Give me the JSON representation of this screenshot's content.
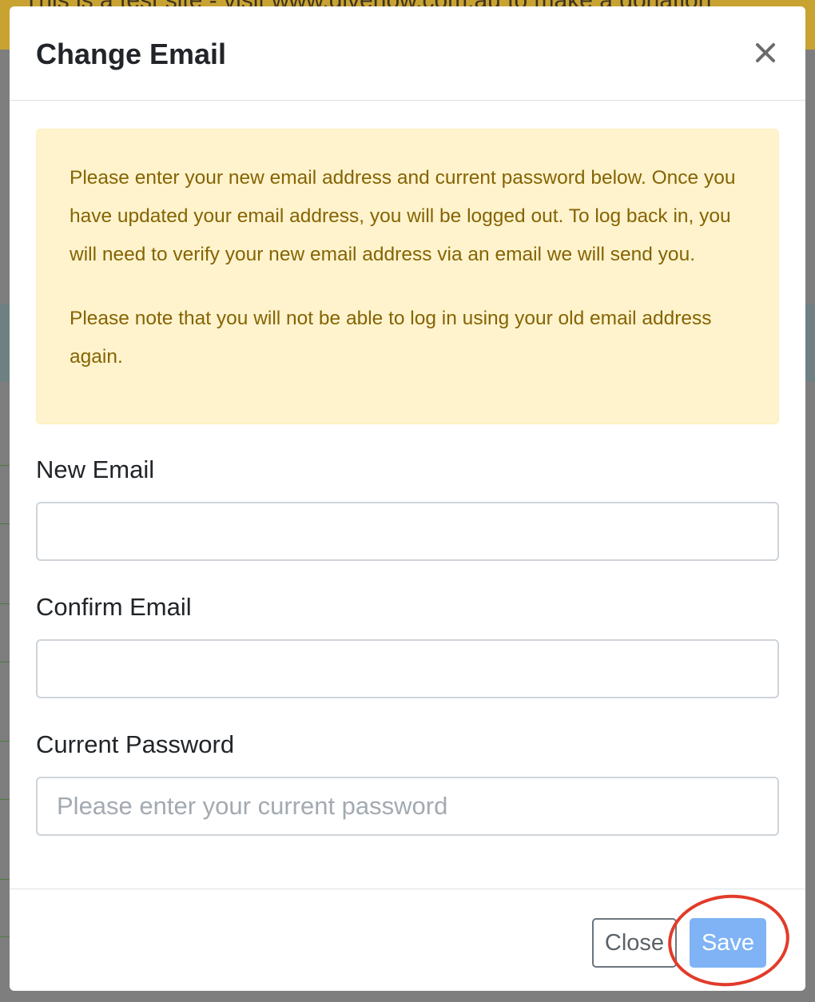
{
  "background": {
    "banner_text": "This is a test site - visit www.givenow.com.au to make a donation"
  },
  "modal": {
    "title": "Change Email",
    "close_glyph": "×",
    "alert": {
      "paragraph_1": "Please enter your new email address and current password below. Once you have updated your email address, you will be logged out. To log back in, you will need to verify your new email address via an email we will send you.",
      "paragraph_2": "Please note that you will not be able to log in using your old email address again."
    },
    "fields": {
      "new_email": {
        "label": "New Email",
        "value": "",
        "placeholder": ""
      },
      "confirm_email": {
        "label": "Confirm Email",
        "value": "",
        "placeholder": ""
      },
      "current_password": {
        "label": "Current Password",
        "value": "",
        "placeholder": "Please enter your current password"
      }
    },
    "footer": {
      "close_label": "Close",
      "save_label": "Save"
    }
  },
  "colors": {
    "alert_bg": "#fff3cd",
    "alert_text": "#856404",
    "save_button": "#7fb3f5",
    "highlight_ring": "#e23b2a"
  },
  "icons": {
    "close": "close-icon"
  }
}
